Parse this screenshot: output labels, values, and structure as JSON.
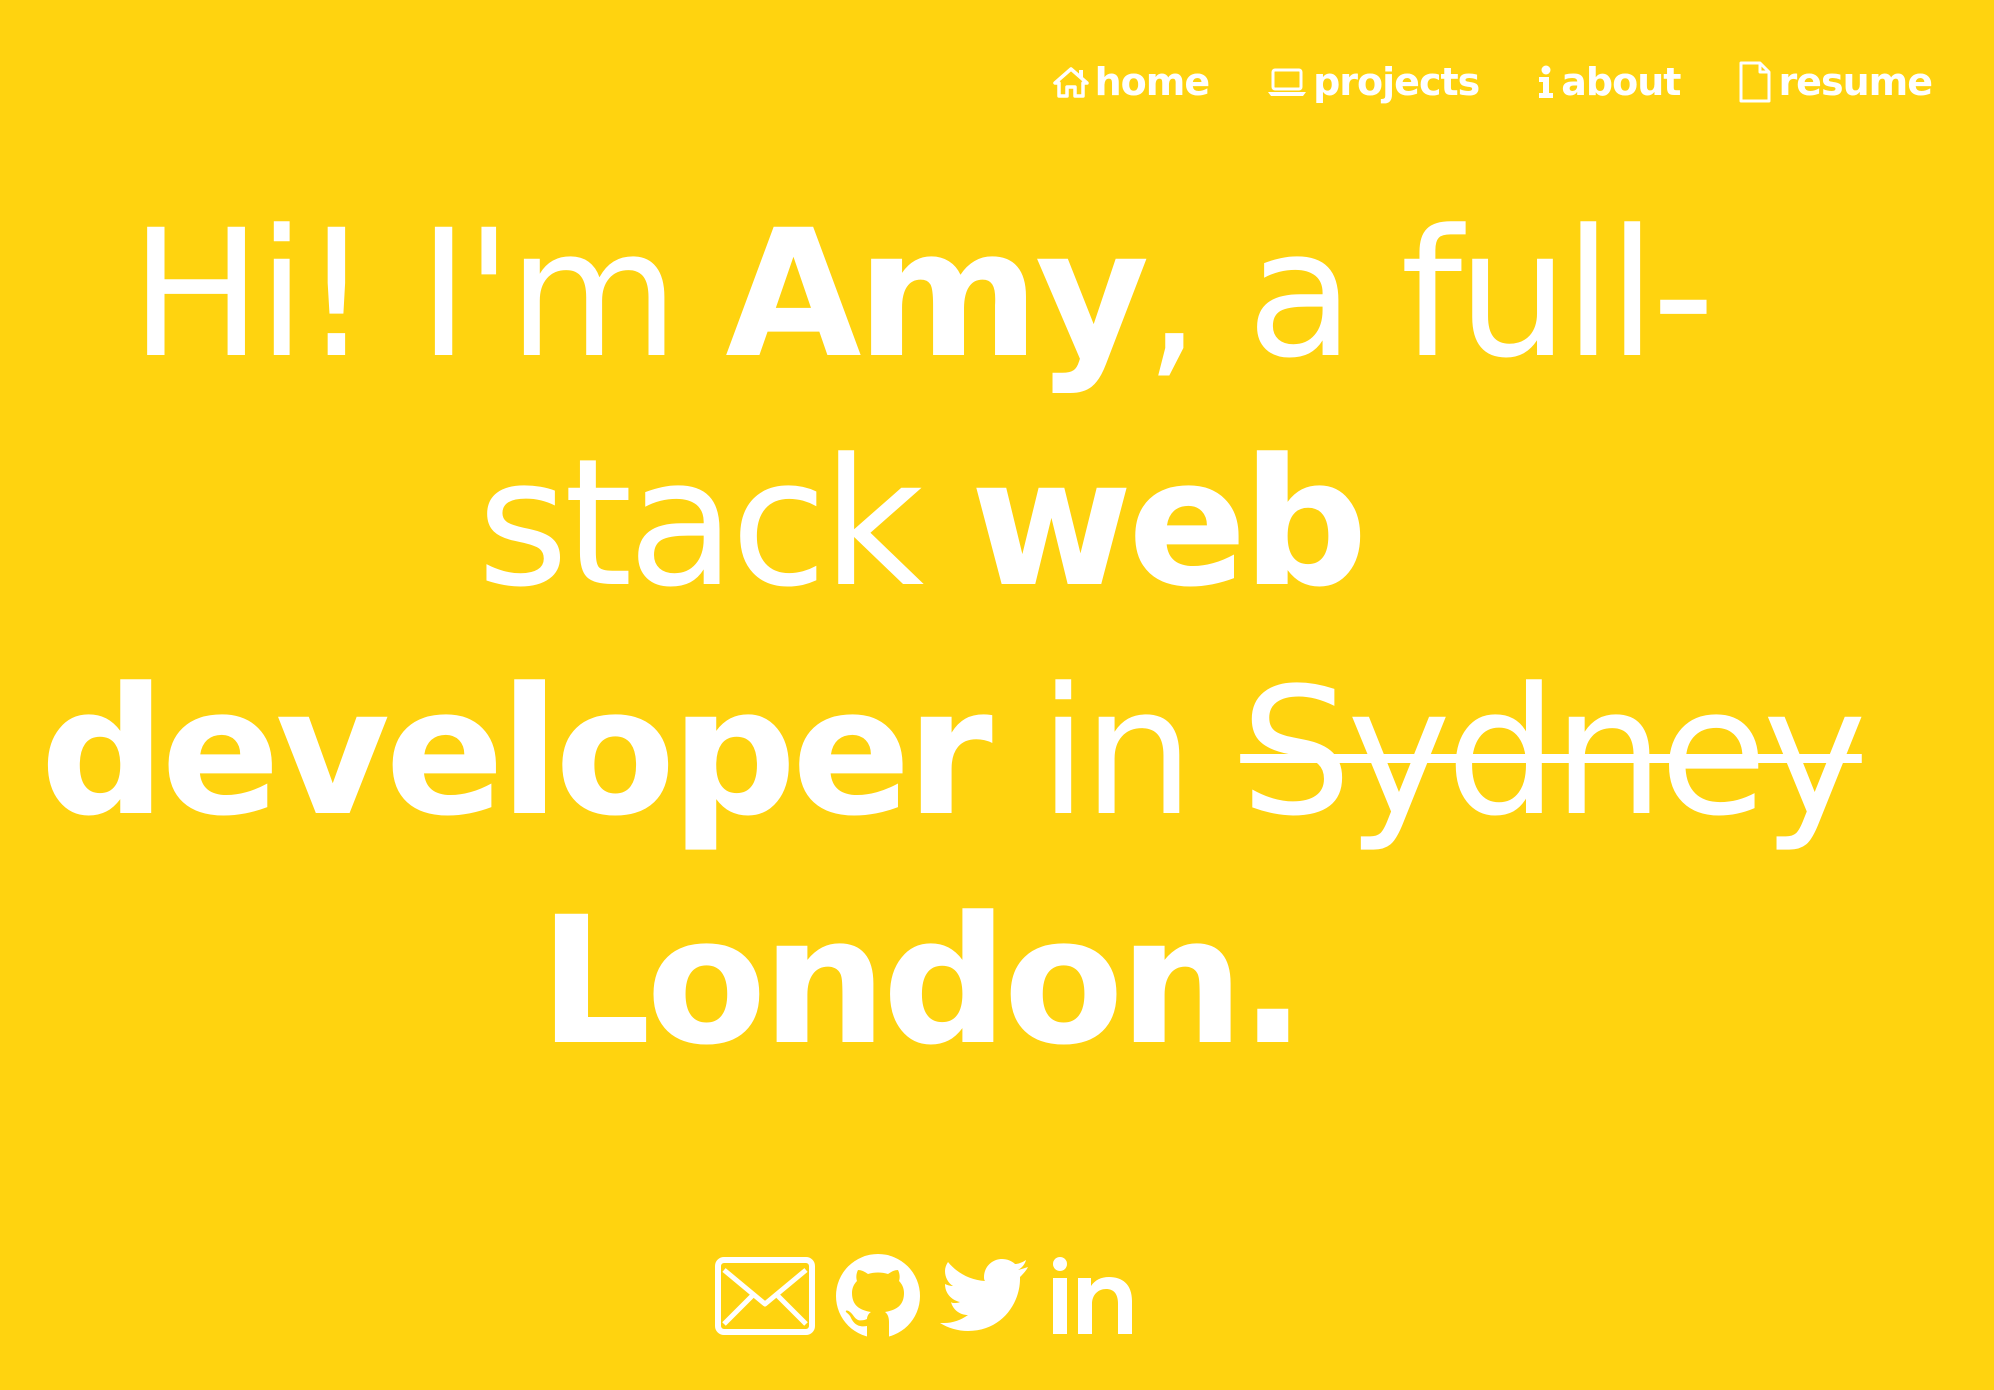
{
  "nav": {
    "items": [
      {
        "label": "home",
        "icon": "home-icon"
      },
      {
        "label": "projects",
        "icon": "laptop-icon"
      },
      {
        "label": "about",
        "icon": "info-icon"
      },
      {
        "label": "resume",
        "icon": "document-icon"
      }
    ]
  },
  "hero": {
    "greeting": "Hi! I'm ",
    "name": "Amy",
    "after_name": ", a full-",
    "stack_text": "stack ",
    "role_web": "web",
    "role_developer": "developer",
    "in_text": " in ",
    "old_city": "Sydney",
    "new_city": "London",
    "period": "."
  },
  "social": {
    "items": [
      {
        "name": "email",
        "icon": "envelope-icon"
      },
      {
        "name": "github",
        "icon": "github-icon"
      },
      {
        "name": "twitter",
        "icon": "twitter-icon"
      },
      {
        "name": "linkedin",
        "icon": "linkedin-icon"
      }
    ]
  },
  "colors": {
    "background": "#FFD30F",
    "text": "#FFFFFF"
  }
}
